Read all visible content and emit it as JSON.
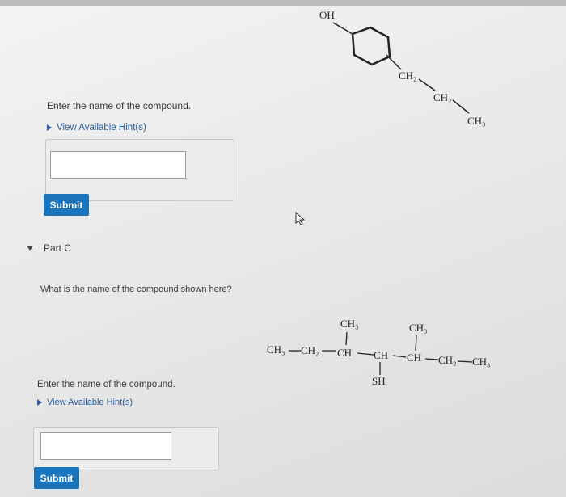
{
  "part_b": {
    "prompt": "Enter the name of the compound.",
    "hint_label": "View Available Hint(s)",
    "answer_value": "",
    "submit_label": "Submit"
  },
  "part_c": {
    "header": "Part C",
    "question": "What is the name of the compound shown here?",
    "prompt": "Enter the name of the compound.",
    "hint_label": "View Available Hint(s)",
    "answer_value": "",
    "submit_label": "Submit"
  },
  "structure_b": {
    "oh": "OH",
    "ch2_a": "CH₂",
    "ch2_b": "CH₂",
    "ch3": "CH₃"
  },
  "structure_c": {
    "ch3_left": "CH₃",
    "ch2_left": "CH₂",
    "ch_1": "CH",
    "ch_2": "CH",
    "ch_3": "CH",
    "ch2_right": "CH₂",
    "ch3_right": "CH₃",
    "branch_ch3_1": "CH₃",
    "branch_ch3_2": "CH₃",
    "branch_sh": "SH"
  },
  "colors": {
    "submit_bg": "#1b75bc",
    "hint_link": "#2c5d9c"
  }
}
